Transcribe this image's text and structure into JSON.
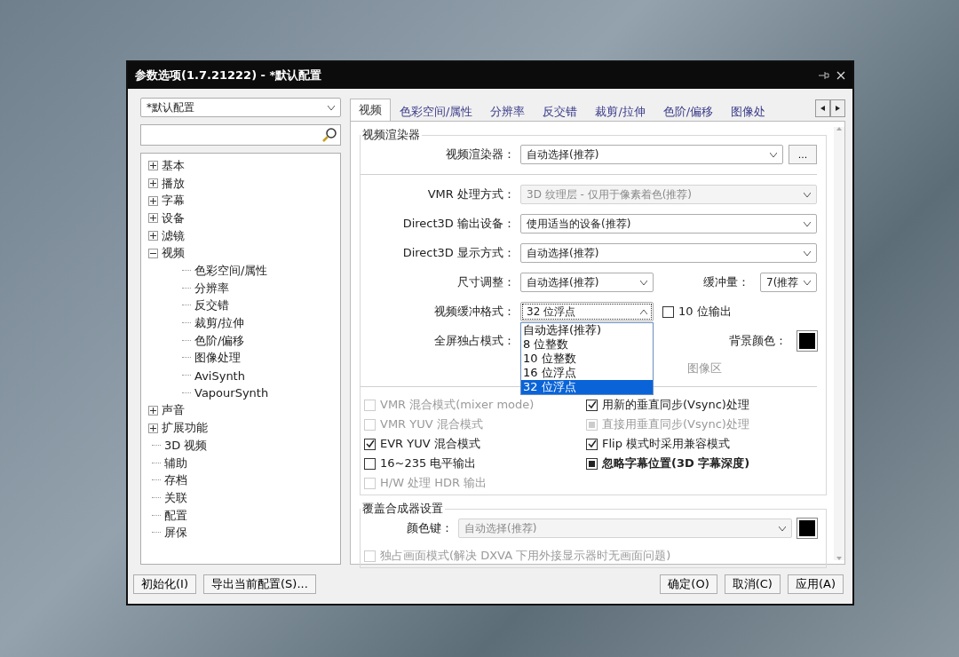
{
  "window": {
    "title": "参数选项(1.7.21222) - *默认配置"
  },
  "sidebar": {
    "profile": "*默认配置",
    "tree": [
      {
        "label": "基本",
        "kind": "folder",
        "expanded": false
      },
      {
        "label": "播放",
        "kind": "folder",
        "expanded": false
      },
      {
        "label": "字幕",
        "kind": "folder",
        "expanded": false
      },
      {
        "label": "设备",
        "kind": "folder",
        "expanded": false
      },
      {
        "label": "滤镜",
        "kind": "folder",
        "expanded": false
      },
      {
        "label": "视频",
        "kind": "folder",
        "expanded": true,
        "children": [
          {
            "label": "色彩空间/属性",
            "kind": "leaf"
          },
          {
            "label": "分辨率",
            "kind": "leaf"
          },
          {
            "label": "反交错",
            "kind": "leaf"
          },
          {
            "label": "裁剪/拉伸",
            "kind": "leaf"
          },
          {
            "label": "色阶/偏移",
            "kind": "leaf"
          },
          {
            "label": "图像处理",
            "kind": "leaf"
          },
          {
            "label": "AviSynth",
            "kind": "leaf"
          },
          {
            "label": "VapourSynth",
            "kind": "leaf"
          }
        ]
      },
      {
        "label": "声音",
        "kind": "folder",
        "expanded": false
      },
      {
        "label": "扩展功能",
        "kind": "folder",
        "expanded": false
      },
      {
        "label": "3D 视频",
        "kind": "leaf"
      },
      {
        "label": "辅助",
        "kind": "leaf"
      },
      {
        "label": "存档",
        "kind": "leaf"
      },
      {
        "label": "关联",
        "kind": "leaf"
      },
      {
        "label": "配置",
        "kind": "leaf"
      },
      {
        "label": "屏保",
        "kind": "leaf"
      }
    ]
  },
  "tabs": [
    {
      "label": "视频",
      "selected": true
    },
    {
      "label": "色彩空间/属性",
      "selected": false
    },
    {
      "label": "分辨率",
      "selected": false
    },
    {
      "label": "反交错",
      "selected": false
    },
    {
      "label": "裁剪/拉伸",
      "selected": false
    },
    {
      "label": "色阶/偏移",
      "selected": false
    },
    {
      "label": "图像处",
      "selected": false
    }
  ],
  "renderer_group": {
    "title": "视频渲染器",
    "label": "视频渲染器：",
    "value": "自动选择(推荐)",
    "button": "..."
  },
  "settings": [
    {
      "kind": "combo",
      "label": "VMR 处理方式：",
      "value": "3D 纹理层 - 仅用于像素着色(推荐)",
      "disabled": true
    },
    {
      "kind": "combo",
      "label": "Direct3D 输出设备：",
      "value": "使用适当的设备(推荐)",
      "disabled": false
    },
    {
      "kind": "combo",
      "label": "Direct3D 显示方式：",
      "value": "自动选择(推荐)",
      "disabled": false
    },
    {
      "kind": "pair",
      "label": "尺寸调整：",
      "value": "自动选择(推荐)",
      "label2": "缓冲量：",
      "value2": "7(推荐"
    },
    {
      "kind": "open",
      "label": "视频缓冲格式：",
      "value": "32 位浮点",
      "check": {
        "label": "10 位输出",
        "checked": false
      },
      "options": [
        {
          "label": "自动选择(推荐)",
          "selected": false
        },
        {
          "label": "8 位整数",
          "selected": false
        },
        {
          "label": "10 位整数",
          "selected": false
        },
        {
          "label": "16 位浮点",
          "selected": false
        },
        {
          "label": "32 位浮点",
          "selected": true
        }
      ]
    },
    {
      "kind": "color",
      "label": "全屏独占模式：",
      "label2": "背景颜色："
    }
  ],
  "hint": "图像区",
  "checks": [
    [
      {
        "label": "VMR 混合模式(mixer mode)",
        "checked": false,
        "disabled": true,
        "indeterminate": false,
        "bold": false
      },
      {
        "label": "VMR YUV 混合模式",
        "checked": false,
        "disabled": true,
        "indeterminate": false,
        "bold": false
      },
      {
        "label": "EVR YUV 混合模式",
        "checked": true,
        "disabled": false,
        "indeterminate": false,
        "bold": false
      },
      {
        "label": "16~235 电平输出",
        "checked": false,
        "disabled": false,
        "indeterminate": false,
        "bold": false
      },
      {
        "label": "H/W 处理 HDR 输出",
        "checked": false,
        "disabled": true,
        "indeterminate": false,
        "bold": false
      }
    ],
    [
      {
        "label": "用新的垂直同步(Vsync)处理",
        "checked": true,
        "disabled": false,
        "indeterminate": false,
        "bold": false
      },
      {
        "label": "直接用垂直同步(Vsync)处理",
        "checked": false,
        "disabled": true,
        "indeterminate": true,
        "bold": false
      },
      {
        "label": "Flip 模式时采用兼容模式",
        "checked": true,
        "disabled": false,
        "indeterminate": false,
        "bold": false
      },
      {
        "label": "忽略字幕位置(3D 字幕深度)",
        "checked": false,
        "disabled": false,
        "indeterminate": true,
        "bold": true
      }
    ]
  ],
  "overlay": {
    "title": "覆盖合成器设置",
    "label": "颜色键：",
    "value": "自动选择(推荐)",
    "disabled": true,
    "check": {
      "label": "独占画面模式(解决 DXVA 下用外接显示器时无画面问题)",
      "checked": false,
      "disabled": true
    }
  },
  "buttons_left": [
    "初始化(I)",
    "导出当前配置(S)..."
  ],
  "buttons_right": [
    "确定(O)",
    "取消(C)",
    "应用(A)"
  ]
}
